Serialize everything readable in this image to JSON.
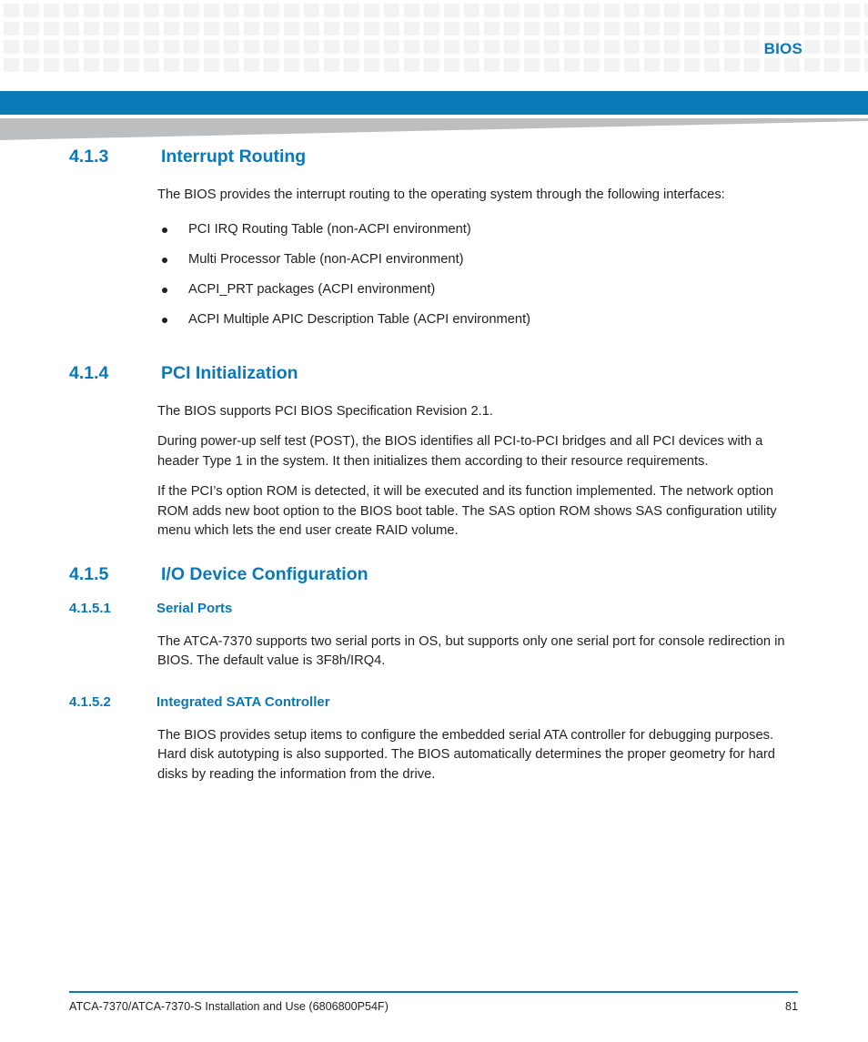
{
  "header": {
    "title": "BIOS"
  },
  "sections": [
    {
      "number": "4.1.3",
      "title": "Interrupt Routing",
      "intro": "The BIOS provides the interrupt routing to the operating system through the following interfaces:",
      "bullets": [
        "PCI IRQ Routing Table (non-ACPI environment)",
        "Multi Processor Table (non-ACPI environment)",
        "ACPI_PRT packages (ACPI environment)",
        "ACPI Multiple APIC Description Table (ACPI environment)"
      ]
    },
    {
      "number": "4.1.4",
      "title": "PCI Initialization",
      "paragraphs": [
        "The BIOS supports PCI BIOS Specification Revision 2.1.",
        "During power-up self test (POST), the BIOS identifies all PCI-to-PCI bridges and all PCI devices with a header Type 1 in the system. It then initializes them according to their resource requirements.",
        "If the PCI’s option ROM is detected, it will be executed and its function implemented. The network option ROM adds new boot option to the BIOS boot table. The SAS option ROM shows SAS configuration utility menu which lets the end user create RAID volume."
      ]
    },
    {
      "number": "4.1.5",
      "title": "I/O Device Configuration",
      "subsections": [
        {
          "number": "4.1.5.1",
          "title": "Serial Ports",
          "paragraphs": [
            "The ATCA-7370 supports two serial ports in OS, but supports only one serial port for console redirection in BIOS. The default value is 3F8h/IRQ4."
          ]
        },
        {
          "number": "4.1.5.2",
          "title": "Integrated SATA Controller",
          "paragraphs": [
            "The BIOS provides setup items to configure the embedded serial ATA controller for debugging purposes. Hard disk autotyping is also supported. The BIOS automatically determines the proper geometry for hard disks by reading the information from the drive."
          ]
        }
      ]
    }
  ],
  "footer": {
    "document": "ATCA-7370/ATCA-7370-S Installation and Use (6806800P54F)",
    "page_number": "81"
  },
  "colors": {
    "accent_blue": "#0b7bb5",
    "heading_blue": "#0b78b8",
    "wedge_gray": "#bcbec0",
    "square_gray": "#f3f3f3",
    "body_text": "#231f20"
  }
}
